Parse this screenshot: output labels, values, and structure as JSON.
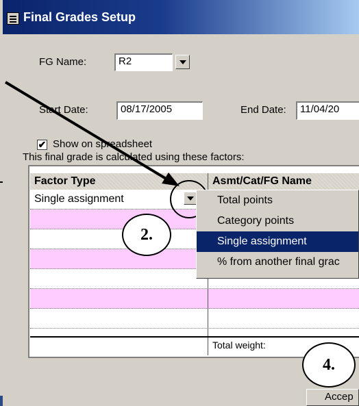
{
  "window": {
    "title": "Final Grades Setup"
  },
  "form": {
    "fg_name_label": "FG Name:",
    "fg_name_value": "R2",
    "start_date_label": "Start Date:",
    "start_date_value": "08/17/2005",
    "end_date_label": "End Date:",
    "end_date_value": "11/04/20",
    "show_on_spreadsheet_label": "Show on spreadsheet",
    "show_on_spreadsheet_checked": true,
    "factors_caption": "This final grade is calculated using these factors:"
  },
  "grid": {
    "columns": [
      "Factor Type",
      "Asmt/Cat/FG Name"
    ],
    "rows": [
      {
        "factor_type": "Single assignment",
        "name": ""
      },
      {
        "factor_type": "",
        "name": ""
      },
      {
        "factor_type": "",
        "name": ""
      },
      {
        "factor_type": "",
        "name": ""
      },
      {
        "factor_type": "",
        "name": ""
      },
      {
        "factor_type": "",
        "name": ""
      },
      {
        "factor_type": "",
        "name": ""
      }
    ],
    "total_weight_label": "Total weight:"
  },
  "factor_type_menu": {
    "options": [
      "Total points",
      "Category points",
      "Single assignment",
      "% from another final grac"
    ],
    "selected": "Single assignment"
  },
  "callouts": {
    "step_2": "2.",
    "step_4": "4."
  },
  "buttons": {
    "accept_label": "Accep"
  },
  "colors": {
    "titlebar": "#0a246a",
    "row_highlight": "#ffccff",
    "menu_selected": "#0a246a",
    "dialog_bg": "#d4d0c8"
  }
}
